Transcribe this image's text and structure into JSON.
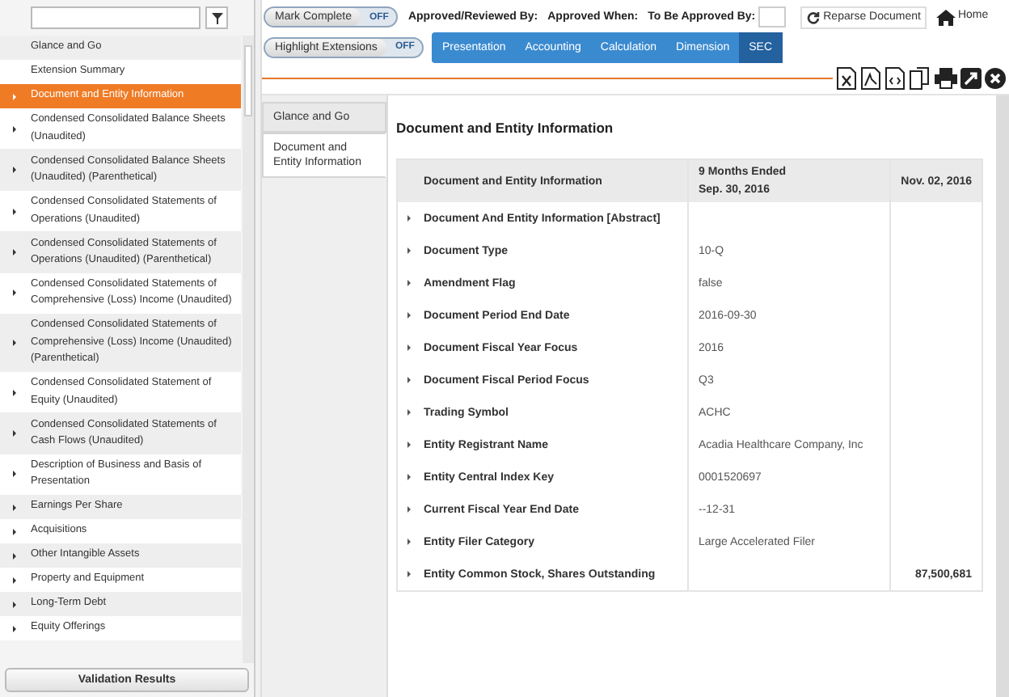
{
  "sidebar": {
    "items": [
      {
        "label": "Glance and Go",
        "expandable": false,
        "selected": false
      },
      {
        "label": "Extension Summary",
        "expandable": false,
        "selected": false
      },
      {
        "label": "Document and Entity Information",
        "expandable": true,
        "selected": true
      },
      {
        "label": "Condensed Consolidated Balance Sheets (Unaudited)",
        "expandable": true,
        "selected": false
      },
      {
        "label": "Condensed Consolidated Balance Sheets (Unaudited) (Parenthetical)",
        "expandable": true,
        "selected": false
      },
      {
        "label": "Condensed Consolidated Statements of Operations (Unaudited)",
        "expandable": true,
        "selected": false
      },
      {
        "label": "Condensed Consolidated Statements of Operations (Unaudited) (Parenthetical)",
        "expandable": true,
        "selected": false
      },
      {
        "label": "Condensed Consolidated Statements of Comprehensive (Loss) Income (Unaudited)",
        "expandable": true,
        "selected": false
      },
      {
        "label": "Condensed Consolidated Statements of Comprehensive (Loss) Income (Unaudited) (Parenthetical)",
        "expandable": true,
        "selected": false
      },
      {
        "label": "Condensed Consolidated Statement of Equity (Unaudited)",
        "expandable": true,
        "selected": false
      },
      {
        "label": "Condensed Consolidated Statements of Cash Flows (Unaudited)",
        "expandable": true,
        "selected": false
      },
      {
        "label": "Description of Business and Basis of Presentation",
        "expandable": true,
        "selected": false
      },
      {
        "label": "Earnings Per Share",
        "expandable": true,
        "selected": false
      },
      {
        "label": "Acquisitions",
        "expandable": true,
        "selected": false
      },
      {
        "label": "Other Intangible Assets",
        "expandable": true,
        "selected": false
      },
      {
        "label": "Property and Equipment",
        "expandable": true,
        "selected": false
      },
      {
        "label": "Long-Term Debt",
        "expandable": true,
        "selected": false
      },
      {
        "label": "Equity Offerings",
        "expandable": true,
        "selected": false
      }
    ],
    "bottom_button": "Validation Results"
  },
  "toggles": [
    {
      "label": "Mark Complete",
      "state_text": "OFF",
      "on": false
    },
    {
      "label": "Highlight Extensions",
      "state_text": "OFF",
      "on": false
    }
  ],
  "approval": {
    "reviewed_by": "Approved/Reviewed By:",
    "approved_when": "Approved When:",
    "to_be_approved_by": "To Be Approved By:"
  },
  "reparse_button": "Reparse Document",
  "home_link": "Home",
  "tabs": [
    {
      "label": "Presentation",
      "selected": false
    },
    {
      "label": "Accounting",
      "selected": false
    },
    {
      "label": "Calculation",
      "selected": false
    },
    {
      "label": "Dimension",
      "selected": false
    },
    {
      "label": "SEC",
      "selected": true
    }
  ],
  "subtabs": [
    {
      "label": "Glance and Go",
      "selected": false
    },
    {
      "label": "Document and Entity Information",
      "selected": true
    }
  ],
  "report": {
    "title": "Document and Entity Information",
    "columns": [
      "Document and Entity Information",
      "9 Months Ended\nSep. 30, 2016",
      "Nov. 02, 2016"
    ],
    "rows": [
      {
        "label": "Document And Entity Information [Abstract]"
      },
      {
        "label": "Document Type",
        "sep_30_2016": "10-Q"
      },
      {
        "label": "Amendment Flag",
        "sep_30_2016": "false"
      },
      {
        "label": "Document Period End Date",
        "sep_30_2016": "2016-09-30"
      },
      {
        "label": "Document Fiscal Year Focus",
        "sep_30_2016": "2016"
      },
      {
        "label": "Document Fiscal Period Focus",
        "sep_30_2016": "Q3"
      },
      {
        "label": "Trading Symbol",
        "sep_30_2016": "ACHC"
      },
      {
        "label": "Entity Registrant Name",
        "sep_30_2016": "Acadia Healthcare Company, Inc"
      },
      {
        "label": "Entity Central Index Key",
        "sep_30_2016": "0001520697"
      },
      {
        "label": "Current Fiscal Year End Date",
        "sep_30_2016": "--12-31"
      },
      {
        "label": "Entity Filer Category",
        "sep_30_2016": "Large Accelerated Filer"
      },
      {
        "label": "Entity Common Stock, Shares Outstanding",
        "nov_02_2016": "87,500,681"
      }
    ]
  }
}
